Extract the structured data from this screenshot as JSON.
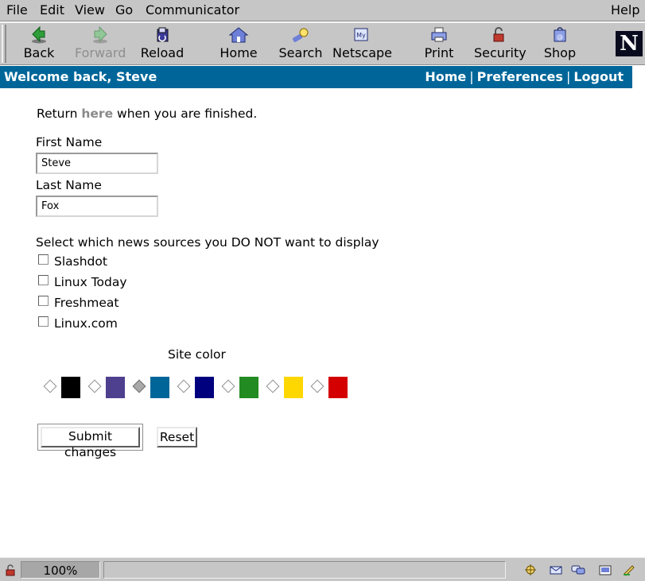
{
  "menubar": {
    "items": [
      "File",
      "Edit",
      "View",
      "Go",
      "Communicator"
    ],
    "help": "Help"
  },
  "toolbar": {
    "buttons": [
      {
        "label": "Back",
        "icon": "back-arrow-icon"
      },
      {
        "label": "Forward",
        "icon": "forward-arrow-icon",
        "disabled": true
      },
      {
        "label": "Reload",
        "icon": "reload-icon"
      },
      {
        "label": "Home",
        "icon": "home-icon"
      },
      {
        "label": "Search",
        "icon": "search-icon"
      },
      {
        "label": "Netscape",
        "icon": "netscape-icon"
      },
      {
        "label": "Print",
        "icon": "print-icon"
      },
      {
        "label": "Security",
        "icon": "security-lock-icon"
      },
      {
        "label": "Shop",
        "icon": "shop-icon"
      }
    ],
    "logo": "N"
  },
  "navbar": {
    "welcome": "Welcome back, Steve",
    "links": [
      "Home",
      "Preferences",
      "Logout"
    ],
    "separator": "|",
    "color": "#006699"
  },
  "content": {
    "return_prefix": "Return ",
    "return_link": "here",
    "return_suffix": " when you are finished.",
    "first_name_label": "First Name",
    "first_name_value": "Steve",
    "last_name_label": "Last Name",
    "last_name_value": "Fox",
    "news_prompt": "Select which news sources you DO NOT want to display",
    "news_sources": [
      {
        "label": "Slashdot",
        "checked": false
      },
      {
        "label": "Linux Today",
        "checked": false
      },
      {
        "label": "Freshmeat",
        "checked": false
      },
      {
        "label": "Linux.com",
        "checked": false
      }
    ],
    "site_color_label": "Site color",
    "site_colors": [
      {
        "color": "#000000",
        "selected": false
      },
      {
        "color": "#4f3f8f",
        "selected": false
      },
      {
        "color": "#006699",
        "selected": true
      },
      {
        "color": "#00007f",
        "selected": false
      },
      {
        "color": "#228b22",
        "selected": false
      },
      {
        "color": "#ffd700",
        "selected": false
      },
      {
        "color": "#d40000",
        "selected": false
      }
    ],
    "submit_label": "Submit changes",
    "reset_label": "Reset"
  },
  "statusbar": {
    "zoom": "100%",
    "message": ""
  }
}
